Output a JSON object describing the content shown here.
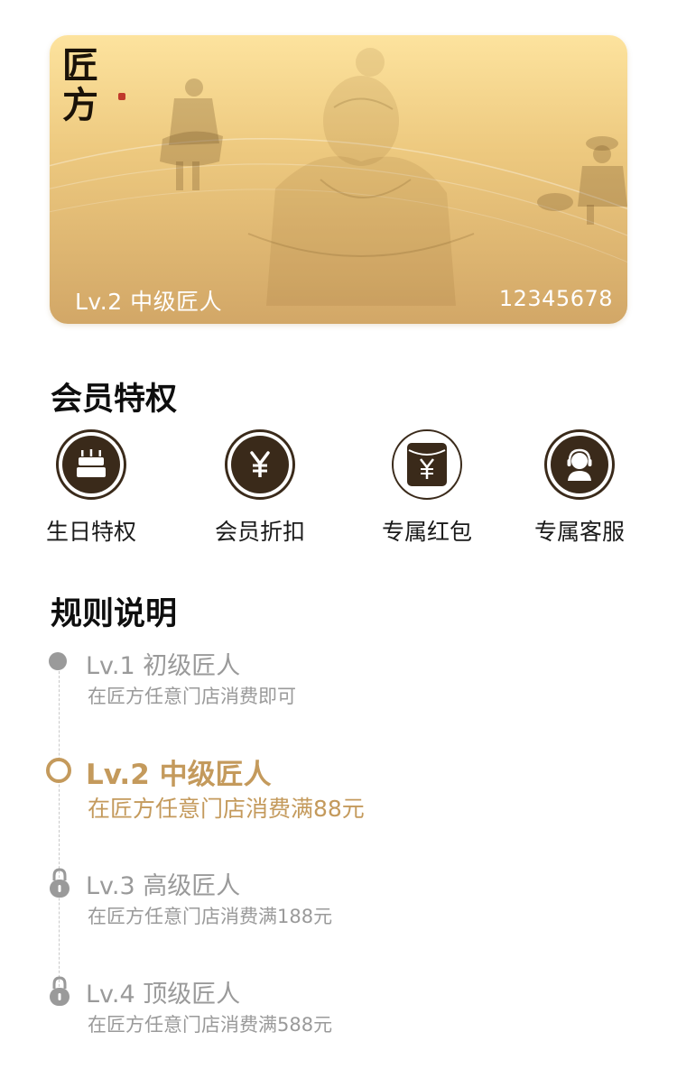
{
  "card": {
    "logo_text": [
      "匠",
      "方"
    ],
    "level": "Lv.2 中级匠人",
    "number": "12345678"
  },
  "privileges": {
    "title": "会员特权",
    "items": [
      {
        "label": "生日特权",
        "icon": "birthday-cake-icon"
      },
      {
        "label": "会员折扣",
        "icon": "yen-icon"
      },
      {
        "label": "专属红包",
        "icon": "red-envelope-icon"
      },
      {
        "label": "专属客服",
        "icon": "customer-service-icon"
      }
    ]
  },
  "rules": {
    "title": "规则说明",
    "levels": [
      {
        "title": "Lv.1 初级匠人",
        "desc": "在匠方任意门店消费即可",
        "state": "achieved"
      },
      {
        "title": "Lv.2 中级匠人",
        "desc": "在匠方任意门店消费满88元",
        "state": "current"
      },
      {
        "title": "Lv.3 高级匠人",
        "desc": "在匠方任意门店消费满188元",
        "state": "locked"
      },
      {
        "title": "Lv.4 顶级匠人",
        "desc": "在匠方任意门店消费满588元",
        "state": "locked"
      }
    ]
  },
  "colors": {
    "accent": "#c49a5c",
    "icon_dark": "#3a2a1a",
    "muted": "#9a9a9a"
  }
}
